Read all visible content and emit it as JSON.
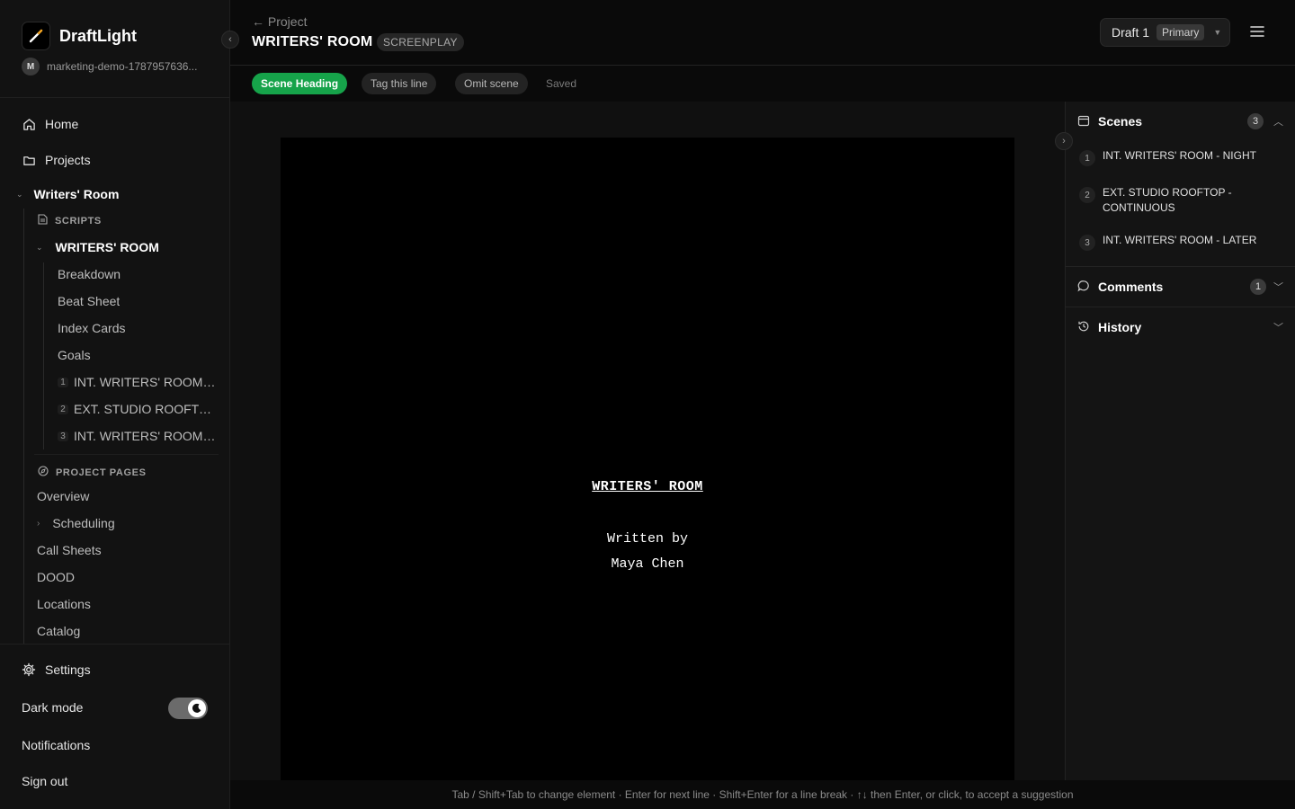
{
  "brand": {
    "name": "DraftLight"
  },
  "workspace": {
    "initial": "M",
    "name": "marketing-demo-1787957636..."
  },
  "nav": {
    "home": "Home",
    "projects": "Projects"
  },
  "project": {
    "name": "Writers' Room",
    "scripts_label": "SCRIPTS",
    "script_name": "WRITERS' ROOM",
    "script_pages": [
      "Breakdown",
      "Beat Sheet",
      "Index Cards",
      "Goals"
    ],
    "scenes": [
      {
        "num": "1",
        "label": "INT. WRITERS' ROOM - NIGHT"
      },
      {
        "num": "2",
        "label": "EXT. STUDIO ROOFTOP - CONTINUOUS"
      },
      {
        "num": "3",
        "label": "INT. WRITERS' ROOM - LATER"
      }
    ],
    "project_pages_label": "PROJECT PAGES",
    "project_pages": {
      "overview": "Overview",
      "scheduling": "Scheduling",
      "call_sheets": "Call Sheets",
      "dood": "DOOD",
      "locations": "Locations",
      "catalog": "Catalog"
    }
  },
  "footer": {
    "settings": "Settings",
    "dark_mode": "Dark mode",
    "dark_mode_on": true,
    "notifications": "Notifications",
    "sign_out": "Sign out"
  },
  "header": {
    "back": "← Project",
    "title": "WRITERS' ROOM",
    "badge": "SCREENPLAY",
    "draft_label": "Draft 1",
    "draft_tag": "Primary"
  },
  "toolbar": {
    "scene_heading": "Scene Heading",
    "tag_line": "Tag this line",
    "omit_scene": "Omit scene",
    "status": "Saved"
  },
  "script": {
    "title": "WRITERS' ROOM",
    "written_by": "Written by",
    "author": "Maya Chen"
  },
  "hint": "Tab / Shift+Tab to change element · Enter for next line · Shift+Enter for a line break · ↑↓ then Enter, or click, to accept a suggestion",
  "panel": {
    "scenes_title": "Scenes",
    "scenes_count": "3",
    "scenes": [
      {
        "num": "1",
        "label": "INT. WRITERS' ROOM - NIGHT"
      },
      {
        "num": "2",
        "label": "EXT. STUDIO ROOFTOP - CONTINUOUS"
      },
      {
        "num": "3",
        "label": "INT. WRITERS' ROOM - LATER"
      }
    ],
    "comments_title": "Comments",
    "comments_count": "1",
    "history_title": "History"
  },
  "colors": {
    "accent": "#16a34a",
    "background": "#0a0a0a",
    "sidebar": "#121212",
    "page": "#000000"
  }
}
